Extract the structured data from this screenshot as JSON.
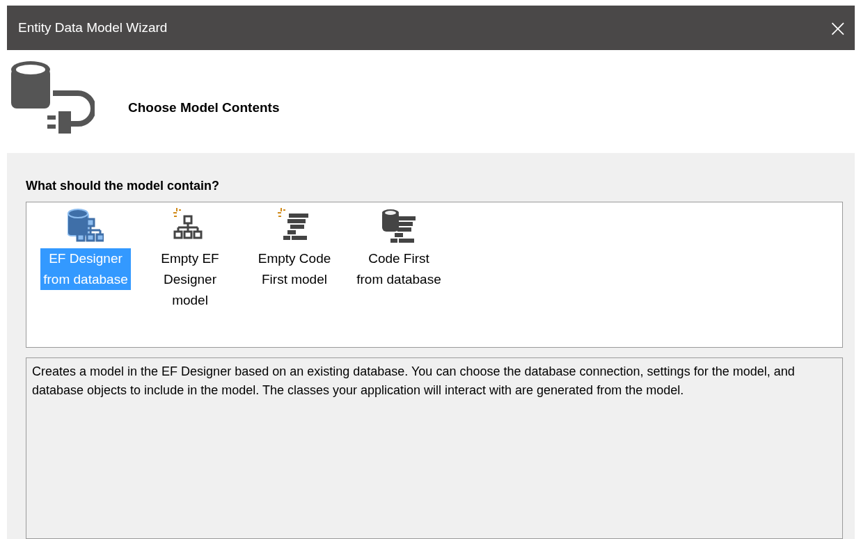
{
  "window": {
    "title": "Entity Data Model Wizard",
    "close": "×"
  },
  "header": {
    "title": "Choose Model Contents"
  },
  "prompt": "What should the model contain?",
  "options": [
    {
      "kind": "designer-db",
      "label": "EF Designer from database",
      "selected": true
    },
    {
      "kind": "designer-empty",
      "label": "Empty EF Designer model",
      "selected": false
    },
    {
      "kind": "code-empty",
      "label": "Empty Code First model",
      "selected": false
    },
    {
      "kind": "code-db",
      "label": "Code First from database",
      "selected": false
    }
  ],
  "description": "Creates a model in the EF Designer based on an existing database. You can choose the database connection, settings for the model, and database objects to include in the model. The classes your application will interact with are generated from the model."
}
